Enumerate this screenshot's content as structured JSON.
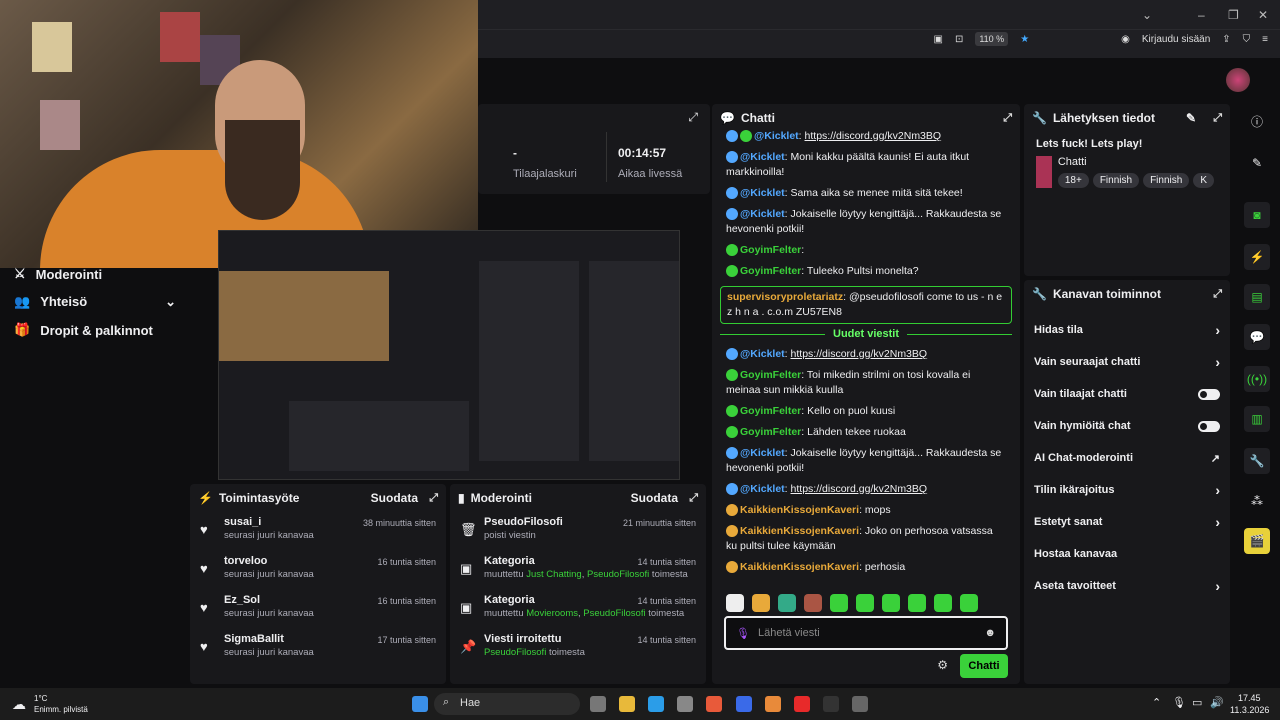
{
  "browser": {
    "zoom": "110 %",
    "login": "Kirjaudu sisään"
  },
  "leftnav": {
    "items": [
      {
        "label": "Moderointi"
      },
      {
        "label": "Yhteisö"
      },
      {
        "label": "Dropit & palkinnot"
      }
    ]
  },
  "stats": {
    "subs_value": "-",
    "subs_label": "Tilaajalaskuri",
    "time_value": "00:14:57",
    "time_label": "Aikaa livessä"
  },
  "chat": {
    "title": "Chatti",
    "top_link": "https://discord.gg/kv2Nm3BQ",
    "messages": [
      {
        "user": "@Kicklet",
        "text": ": Moni kakku päältä kaunis! Ei auta itkut markkinoilla!",
        "color": "#53a8ff"
      },
      {
        "user": "@Kicklet",
        "text": ": Sama aika se menee mitä sitä tekee!",
        "color": "#53a8ff"
      },
      {
        "user": "@Kicklet",
        "text": ": Jokaiselle löytyy kengittäjä... Rakkaudesta se hevonenki potkii!",
        "color": "#53a8ff"
      },
      {
        "user": "GoyimFelter",
        "text": ":",
        "color": "#3ad13a"
      },
      {
        "user": "GoyimFelter",
        "text": ": Tuleeko Pultsi monelta?",
        "color": "#3ad13a"
      }
    ],
    "highlight": {
      "user": "supervisoryproletariatz",
      "text": ": @pseudofilosofi come to us - n e z h n a . c.o.m ZU57EN8"
    },
    "divider": "Uudet viestit",
    "messages2": [
      {
        "user": "@Kicklet",
        "text": ": ",
        "link": "https://discord.gg/kv2Nm3BQ",
        "color": "#53a8ff"
      },
      {
        "user": "GoyimFelter",
        "text": ": Toi mikedin strilmi on tosi kovalla ei meinaa sun mikkiä kuulla",
        "color": "#3ad13a"
      },
      {
        "user": "GoyimFelter",
        "text": ": Kello on puol kuusi",
        "color": "#3ad13a"
      },
      {
        "user": "GoyimFelter",
        "text": ": Lähden tekee ruokaa",
        "color": "#3ad13a"
      },
      {
        "user": "@Kicklet",
        "text": ": Jokaiselle löytyy kengittäjä... Rakkaudesta se hevonenki potkii!",
        "color": "#53a8ff"
      },
      {
        "user": "@Kicklet",
        "text": ": ",
        "link": "https://discord.gg/kv2Nm3BQ",
        "color": "#53a8ff"
      },
      {
        "user": "KaikkienKissojenKaveri",
        "text": ": mops",
        "color": "#e8a93a"
      },
      {
        "user": "KaikkienKissojenKaveri",
        "text": ": Joko on perhosoa vatsassa ku pultsi tulee käymään",
        "color": "#e8a93a"
      },
      {
        "user": "KaikkienKissojenKaveri",
        "text": ": perhosia",
        "color": "#e8a93a"
      }
    ],
    "input_placeholder": "Lähetä viesti",
    "send_label": "Chatti"
  },
  "info": {
    "title": "Lähetyksen tiedot",
    "stream_title": "Lets fuck! Lets play!",
    "category": "Chatti",
    "tags": [
      "18+",
      "Finnish",
      "Finnish",
      "K"
    ]
  },
  "channel": {
    "title": "Kanavan toiminnot",
    "rows": [
      {
        "label": "Hidas tila",
        "control": "chevron"
      },
      {
        "label": "Vain seuraajat chatti",
        "control": "chevron"
      },
      {
        "label": "Vain tilaajat chatti",
        "control": "toggle"
      },
      {
        "label": "Vain hymiöitä chat",
        "control": "toggle"
      },
      {
        "label": "AI Chat-moderointi",
        "control": "external"
      },
      {
        "label": "Tilin ikärajoitus",
        "control": "chevron"
      },
      {
        "label": "Estetyt sanat",
        "control": "chevron"
      },
      {
        "label": "Hostaa kanavaa",
        "control": "none"
      },
      {
        "label": "Aseta tavoitteet",
        "control": "chevron"
      }
    ]
  },
  "activity": {
    "title": "Toimintasyöte",
    "filter": "Suodata",
    "rows": [
      {
        "name": "susai_i",
        "sub": "seurasi juuri kanavaa",
        "time": "38 minuuttia sitten"
      },
      {
        "name": "torveloo",
        "sub": "seurasi juuri kanavaa",
        "time": "16 tuntia sitten"
      },
      {
        "name": "Ez_Sol",
        "sub": "seurasi juuri kanavaa",
        "time": "16 tuntia sitten"
      },
      {
        "name": "SigmaBallit",
        "sub": "seurasi juuri kanavaa",
        "time": "17 tuntia sitten"
      }
    ]
  },
  "moderation": {
    "title": "Moderointi",
    "filter": "Suodata",
    "rows": [
      {
        "name": "PseudoFilosofi",
        "sub_pre": "poisti viestin",
        "g1": "",
        "mid": "",
        "g2": "",
        "post": "",
        "time": "21 minuuttia sitten",
        "icon": "trash"
      },
      {
        "name": "Kategoria",
        "sub_pre": "muuttettu ",
        "g1": "Just Chatting",
        "mid": ", ",
        "g2": "PseudoFilosofi",
        "post": " toimesta",
        "time": "14 tuntia sitten",
        "icon": "box"
      },
      {
        "name": "Kategoria",
        "sub_pre": "muuttettu ",
        "g1": "Movierooms",
        "mid": ", ",
        "g2": "PseudoFilosofi",
        "post": " toimesta",
        "time": "14 tuntia sitten",
        "icon": "box"
      },
      {
        "name": "Viesti irroitettu",
        "sub_pre": "",
        "g1": "",
        "mid": "",
        "g2": "PseudoFilosofi",
        "post": " toimesta",
        "time": "14 tuntia sitten",
        "icon": "pin"
      }
    ]
  },
  "taskbar": {
    "weather_temp": "1°C",
    "weather_desc": "Enimm. pilvistä",
    "search": "Hae",
    "time": "17.45",
    "date": "11.3.2026"
  }
}
